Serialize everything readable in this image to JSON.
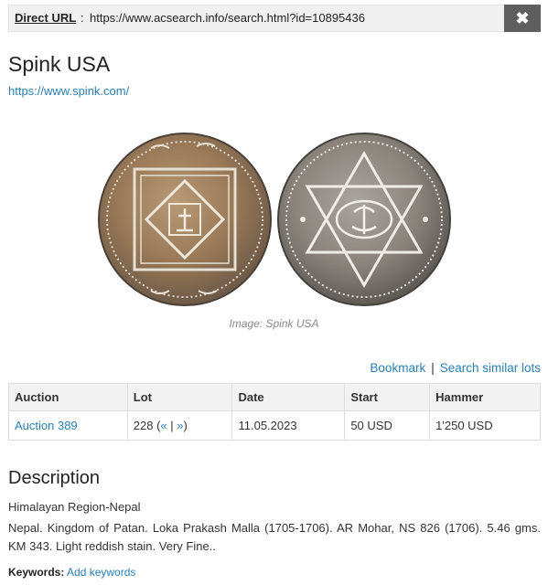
{
  "url_bar": {
    "label": "Direct URL",
    "url": "https://www.acsearch.info/search.html?id=10895436",
    "close_icon": "close-icon"
  },
  "auction_house": {
    "name": "Spink USA",
    "website": "https://www.spink.com/"
  },
  "image": {
    "caption": "Image: Spink USA"
  },
  "actions": {
    "bookmark": "Bookmark",
    "separator": "|",
    "search_similar": "Search similar lots"
  },
  "table": {
    "headers": {
      "auction": "Auction",
      "lot": "Lot",
      "date": "Date",
      "start": "Start",
      "hammer": "Hammer"
    },
    "row": {
      "auction": "Auction 389",
      "lot": "228",
      "prev": "«",
      "next": "»",
      "date": "11.05.2023",
      "start": "50 USD",
      "hammer": "1'250 USD"
    }
  },
  "description": {
    "heading": "Description",
    "region": "Himalayan Region-Nepal",
    "text": "Nepal. Kingdom of Patan. Loka Prakash Malla (1705-1706). AR Mohar, NS 826 (1706). 5.46 gms. KM 343. Light reddish stain. Very Fine.."
  },
  "keywords": {
    "label": "Keywords:",
    "add": "Add keywords"
  }
}
